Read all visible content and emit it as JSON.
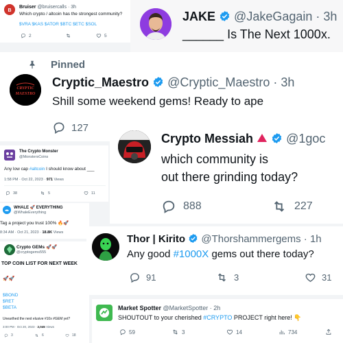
{
  "bruiser": {
    "name": "Bruiser",
    "handle": "@bruisercalls",
    "time": "· 3h",
    "text": "Which crypto / altcoin has the strongest community?",
    "tickers": "$VRA $KAS $ATOR $BTC $ETC $SOL",
    "replies": "2",
    "likes": "5"
  },
  "jake": {
    "name": "JAKE",
    "handle": "@JakeGagain · 3h",
    "text": "______ Is The Next 1000x."
  },
  "maestro": {
    "pinned_label": "Pinned",
    "name": "Cryptic_Maestro",
    "handle": "@Cryptic_Maestro · 3h",
    "avatar_text": "CRYPTIC MAESTRO",
    "text": "Shill some weekend gems! Ready to ape",
    "replies": "127"
  },
  "monster": {
    "name": "The Crypto Monster",
    "handle": "@MonstersCoins",
    "text_before": "Any low cap ",
    "tag": "#altcoin",
    "text_after": " I should know about ___",
    "timestamp": "1:58 PM · Oct 22, 2023 ·",
    "views": "971",
    "views_label": "Views",
    "replies": "38",
    "retweets": "5",
    "likes": "11"
  },
  "messiah": {
    "name": "Crypto Messiah",
    "handle": "@1goc",
    "line1": "which community is",
    "line2": "out there grinding today?",
    "replies": "888",
    "retweets": "227"
  },
  "whale": {
    "name": "WHALE 🚀 EVERYTHING",
    "handle": "@WhaleEverything",
    "text": "Tag a project you trust 100% 🔥🚀",
    "timestamp": "8:34 AM · Oct 21, 2023 ·",
    "views": "18.8K",
    "views_label": "Views"
  },
  "gems": {
    "name": "Crypto GEMs 🚀🚀",
    "handle": "@cryptogems555",
    "heading": "TOP COIN LIST FOR NEXT WEEK",
    "rockets": "🚀🚀",
    "coins": [
      "$BOND",
      "$RET",
      "$BETA"
    ],
    "footer": "Unearthed the next elusive #10x #GEM yet?",
    "timestamp": "3:00 PM · Oct 20, 2023 ·",
    "views": "2,045",
    "views_label": "Views",
    "replies": "3",
    "retweets": "6",
    "likes": "18"
  },
  "thor": {
    "name": "Thor | Kirito",
    "handle": "@Thorshammergems · 1h",
    "text_before": "Any good ",
    "tag": "#1000X",
    "text_after": " gems out there today?",
    "replies": "91",
    "retweets": "3",
    "likes": "31"
  },
  "spotter": {
    "name": "Market Spotter",
    "handle": "@MarketSpotter · 2h",
    "text_before": "SHOUTOUT to your cherished ",
    "tag": "#CRYPTO",
    "text_after": " PROJECT right here! 👇",
    "replies": "59",
    "retweets": "3",
    "likes": "14",
    "views": "734"
  },
  "colors": {
    "verified": "#1d9bf0",
    "link": "#1d9bf0",
    "muted": "#536471",
    "red_triangle": "#e0245e",
    "spotter_green": "#3fb950"
  }
}
